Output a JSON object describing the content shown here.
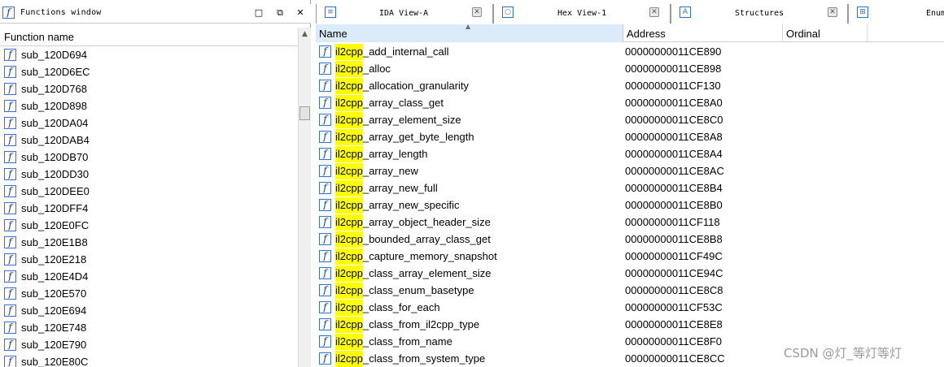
{
  "functions_window": {
    "title": "Functions window",
    "column_header": "Function name",
    "controls": {
      "restore": "□",
      "float": "⧉",
      "close": "✕"
    },
    "items": [
      "sub_120D694",
      "sub_120D6EC",
      "sub_120D768",
      "sub_120D898",
      "sub_120DA04",
      "sub_120DAB4",
      "sub_120DB70",
      "sub_120DD30",
      "sub_120DEE0",
      "sub_120DFF4",
      "sub_120E0FC",
      "sub_120E1B8",
      "sub_120E218",
      "sub_120E4D4",
      "sub_120E570",
      "sub_120E694",
      "sub_120E748",
      "sub_120E790",
      "sub_120E80C"
    ]
  },
  "tabs": [
    {
      "label": "IDA View-A",
      "icon": "ida-view-icon"
    },
    {
      "label": "Hex View-1",
      "icon": "hex-view-icon"
    },
    {
      "label": "Structures",
      "icon": "structures-icon"
    },
    {
      "label": "Enums",
      "icon": "enums-icon"
    }
  ],
  "exports_table": {
    "columns": {
      "name": "Name",
      "address": "Address",
      "ordinal": "Ordinal"
    },
    "highlight_prefix": "il2cpp",
    "highlight_color": "#ffff00",
    "rows": [
      {
        "prefix": "il2cpp",
        "rest": "_add_internal_call",
        "address": "00000000011CE890"
      },
      {
        "prefix": "il2cpp",
        "rest": "_alloc",
        "address": "00000000011CE898"
      },
      {
        "prefix": "il2cpp",
        "rest": "_allocation_granularity",
        "address": "00000000011CF130"
      },
      {
        "prefix": "il2cpp",
        "rest": "_array_class_get",
        "address": "00000000011CE8A0"
      },
      {
        "prefix": "il2cpp",
        "rest": "_array_element_size",
        "address": "00000000011CE8C0"
      },
      {
        "prefix": "il2cpp",
        "rest": "_array_get_byte_length",
        "address": "00000000011CE8A8"
      },
      {
        "prefix": "il2cpp",
        "rest": "_array_length",
        "address": "00000000011CE8A4"
      },
      {
        "prefix": "il2cpp",
        "rest": "_array_new",
        "address": "00000000011CE8AC"
      },
      {
        "prefix": "il2cpp",
        "rest": "_array_new_full",
        "address": "00000000011CE8B4"
      },
      {
        "prefix": "il2cpp",
        "rest": "_array_new_specific",
        "address": "00000000011CE8B0"
      },
      {
        "prefix": "il2cpp",
        "rest": "_array_object_header_size",
        "address": "00000000011CF118"
      },
      {
        "prefix": "il2cpp",
        "rest": "_bounded_array_class_get",
        "address": "00000000011CE8B8"
      },
      {
        "prefix": "il2cpp",
        "rest": "_capture_memory_snapshot",
        "address": "00000000011CF49C"
      },
      {
        "prefix": "il2cpp",
        "rest": "_class_array_element_size",
        "address": "00000000011CE94C"
      },
      {
        "prefix": "il2cpp",
        "rest": "_class_enum_basetype",
        "address": "00000000011CE8C8"
      },
      {
        "prefix": "il2cpp",
        "rest": "_class_for_each",
        "address": "00000000011CF53C"
      },
      {
        "prefix": "il2cpp",
        "rest": "_class_from_il2cpp_type",
        "address": "00000000011CE8E8"
      },
      {
        "prefix": "il2cpp",
        "rest": "_class_from_name",
        "address": "00000000011CE8F0"
      },
      {
        "prefix": "il2cpp",
        "rest": "_class_from_system_type",
        "address": "00000000011CE8CC"
      }
    ]
  },
  "watermark": "CSDN @灯_等灯等灯"
}
